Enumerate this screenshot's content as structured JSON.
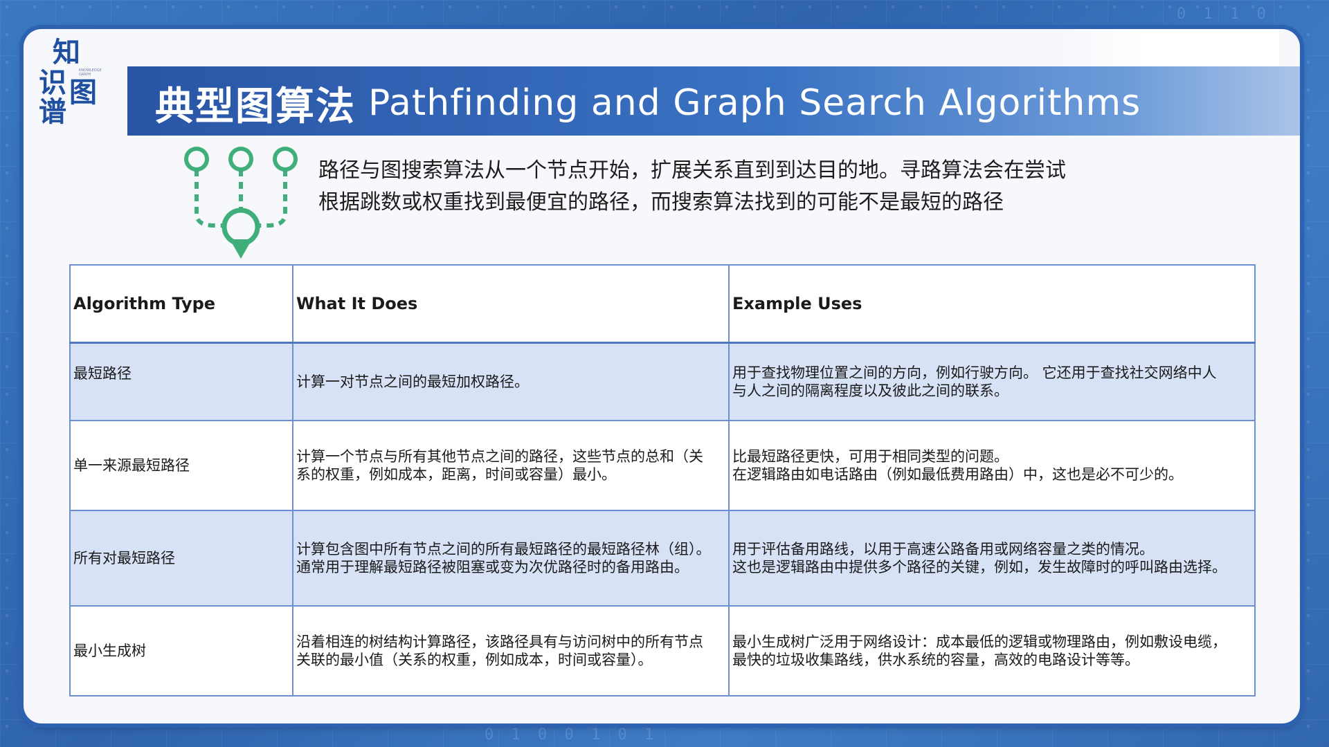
{
  "logo": {
    "chars": [
      "知",
      "识",
      "图",
      "谱"
    ],
    "sub_text": "KNOWLEDGE GRAPH"
  },
  "title": {
    "chinese": "典型图算法",
    "english": "Pathfinding and Graph Search Algorithms"
  },
  "intro": {
    "lines": [
      "路径与图搜索算法从一个节点开始，扩展关系直到到达目的地。寻路算法会在尝试",
      "根据跳数或权重找到最便宜的路径，而搜索算法找到的可能不是最短的路径"
    ]
  },
  "table": {
    "headers": [
      "Algorithm Type",
      "What It Does",
      "Example Uses"
    ],
    "rows": [
      {
        "type": "最短路径",
        "does": [
          "计算一对节点之间的最短加权路径。"
        ],
        "uses": [
          "用于查找物理位置之间的方向，例如行驶方向。 它还用于查找社交网络中人",
          "与人之间的隔离程度以及彼此之间的联系。"
        ]
      },
      {
        "type": "单一来源最短路径",
        "does": [
          "计算一个节点与所有其他节点之间的路径，这些节点的总和（关",
          "系的权重，例如成本，距离，时间或容量）最小。"
        ],
        "uses": [
          "比最短路径更快，可用于相同类型的问题。",
          "在逻辑路由如电话路由（例如最低费用路由）中，这也是必不可少的。"
        ]
      },
      {
        "type": "所有对最短路径",
        "does": [
          "计算包含图中所有节点之间的所有最短路径的最短路径林（组）。",
          "通常用于理解最短路径被阻塞或变为次优路径时的备用路由。"
        ],
        "uses": [
          "用于评估备用路线，以用于高速公路备用或网络容量之类的情况。",
          "这也是逻辑路由中提供多个路径的关键，例如，发生故障时的呼叫路由选择。"
        ]
      },
      {
        "type": "最小生成树",
        "does": [
          "沿着相连的树结构计算路径，该路径具有与访问树中的所有节点",
          "关联的最小值（关系的权重，例如成本，时间或容量）。"
        ],
        "uses": [
          "最小生成树广泛用于网络设计：成本最低的逻辑或物理路由，例如敷设电缆，",
          "最快的垃圾收集路线，供水系统的容量，高效的电路设计等等。"
        ]
      }
    ]
  },
  "colors": {
    "title_bar": "#2a55a6",
    "frame": "#2d62b3",
    "row_shade": "#d7e2f6",
    "icon_green": "#3fae7a"
  },
  "icons": {
    "path_icon": "pathfinding-branch-icon"
  }
}
